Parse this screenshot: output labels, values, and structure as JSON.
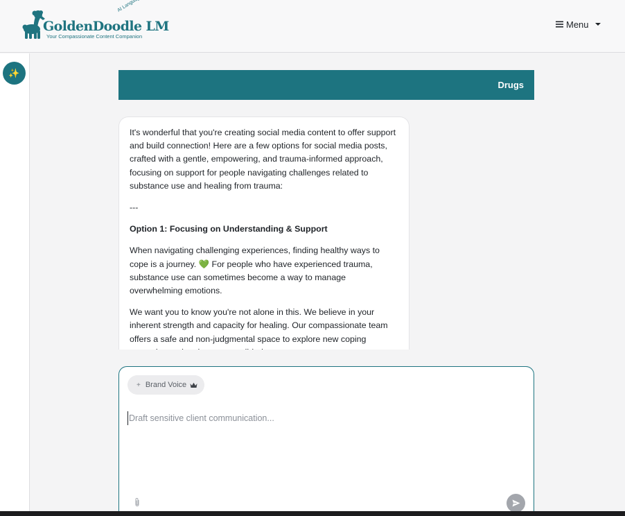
{
  "header": {
    "logo_wordmark": "GoldenDoodle LM",
    "logo_tagline": "Your Compassionate Content Companion",
    "logo_arc_text": "AI Language Model",
    "menu_label": "Menu"
  },
  "sidebar": {
    "magic_icon": "sparkles-icon"
  },
  "topic": {
    "label": "Drugs"
  },
  "message": {
    "intro": "It's wonderful that you're creating social media content to offer support and build connection! Here are a few options for social media posts, crafted with a gentle, empowering, and trauma-informed approach, focusing on support for people navigating challenges related to substance use and healing from trauma:",
    "divider": "---",
    "option1_heading": "Option 1: Focusing on Understanding & Support",
    "para1_before": "When navigating challenging experiences, finding healthy ways to cope is a journey. ",
    "para1_emoji": "💚",
    "para1_after": " For people who have experienced trauma, substance use can sometimes become a way to manage overwhelming emotions.",
    "para2": "We want you to know you're not alone in this. We believe in your inherent strength and capacity for healing. Our compassionate team offers a safe and non-judgmental space to explore new coping strategies and pathways to well-being."
  },
  "composer": {
    "brand_voice_label": "Brand Voice",
    "brand_voice_icon": "crown-icon",
    "placeholder": "Draft sensitive client communication...",
    "attach_icon": "paperclip-icon",
    "send_icon": "send-icon"
  },
  "colors": {
    "accent": "#1d7480",
    "send_disabled": "#a3a6ac"
  }
}
